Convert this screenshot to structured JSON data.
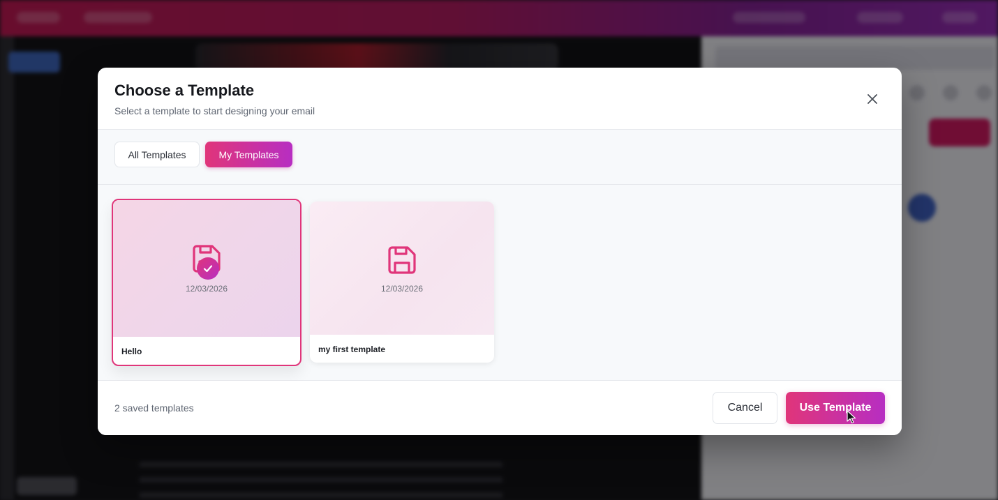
{
  "modal": {
    "title": "Choose a Template",
    "subtitle": "Select a template to start designing your email",
    "close_icon": "close-icon"
  },
  "tabs": [
    {
      "label": "All Templates",
      "active": false
    },
    {
      "label": "My Templates",
      "active": true
    }
  ],
  "templates": [
    {
      "name": "Hello",
      "date": "12/03/2026",
      "selected": true,
      "icon": "save-icon"
    },
    {
      "name": "my first template",
      "date": "12/03/2026",
      "selected": false,
      "icon": "save-icon"
    }
  ],
  "footer": {
    "count_text": "2 saved templates",
    "cancel_label": "Cancel",
    "use_label": "Use Template"
  },
  "colors": {
    "accent_start": "#e0357a",
    "accent_end": "#b72ec2"
  }
}
